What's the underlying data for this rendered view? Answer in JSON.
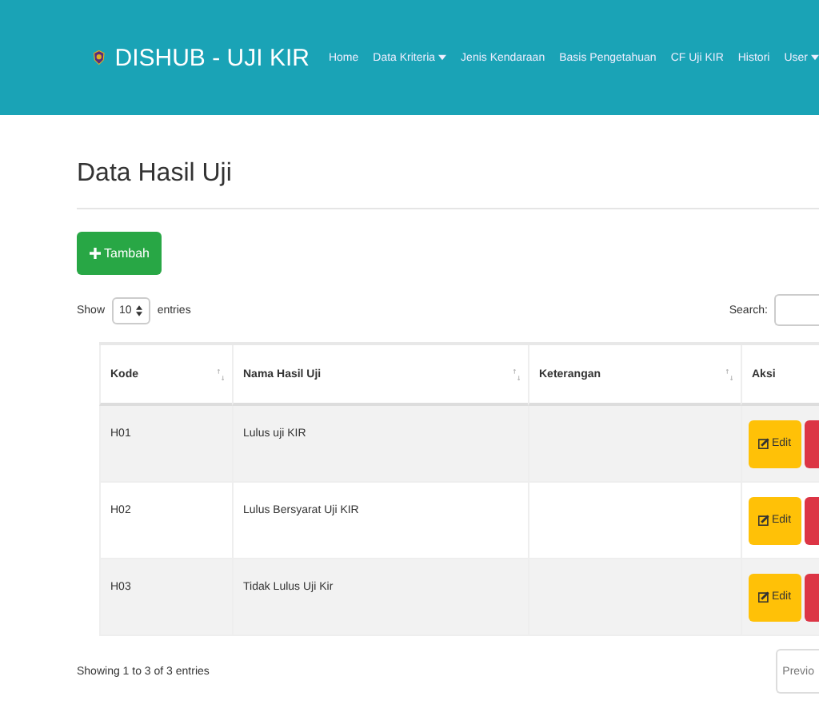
{
  "navbar": {
    "brand": "DISHUB - UJI KIR",
    "items": [
      {
        "label": "Home",
        "dropdown": false
      },
      {
        "label": "Data Kriteria",
        "dropdown": true
      },
      {
        "label": "Jenis Kendaraan",
        "dropdown": false
      },
      {
        "label": "Basis Pengetahuan",
        "dropdown": false
      },
      {
        "label": "CF Uji KIR",
        "dropdown": false
      },
      {
        "label": "Histori",
        "dropdown": false
      },
      {
        "label": "User",
        "dropdown": true
      }
    ]
  },
  "page_title": "Data Hasil Uji",
  "add_button": "Tambah",
  "length_control": {
    "before": "Show",
    "value": "10",
    "after": "entries"
  },
  "search": {
    "label": "Search:"
  },
  "table": {
    "columns": [
      "Kode",
      "Nama Hasil Uji",
      "Keterangan",
      "Aksi"
    ],
    "rows": [
      {
        "kode": "H01",
        "nama": "Lulus uji KIR",
        "keterangan": "",
        "edit": "Edit"
      },
      {
        "kode": "H02",
        "nama": "Lulus Bersyarat Uji KIR",
        "keterangan": "",
        "edit": "Edit"
      },
      {
        "kode": "H03",
        "nama": "Tidak Lulus Uji Kir",
        "keterangan": "",
        "edit": "Edit"
      }
    ]
  },
  "info": "Showing 1 to 3 of 3 entries",
  "pagination": {
    "previous": "Previo"
  }
}
